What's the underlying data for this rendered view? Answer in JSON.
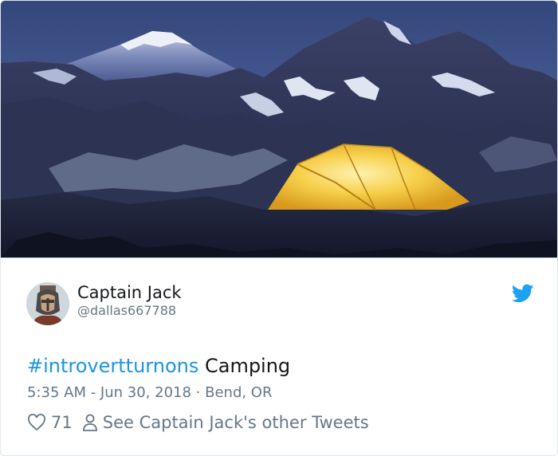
{
  "tweet": {
    "author_name": "Captain Jack",
    "author_handle": "@dallas667788",
    "hashtag": "#introvertturnons",
    "text": " Camping",
    "timestamp": "5:35 AM - Jun 30, 2018",
    "separator": " · ",
    "location": "Bend, OR",
    "like_count": "71",
    "profile_link_label": "See Captain Jack's other Tweets"
  },
  "icons": {
    "logo": "twitter-bird-icon",
    "like": "heart-icon",
    "profile": "person-icon"
  },
  "colors": {
    "link": "#1b95e0",
    "text": "#14171a",
    "muted": "#657786",
    "border": "#e1e8ed",
    "tent": "#f2c23a"
  }
}
